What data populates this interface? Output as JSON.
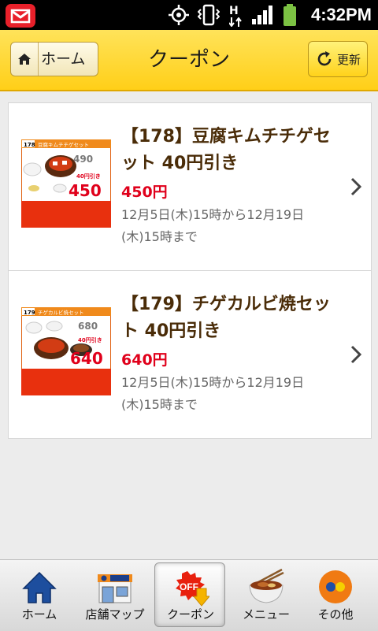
{
  "status_bar": {
    "time": "4:32PM",
    "icons": [
      "mail-icon",
      "gps-icon",
      "vibrate-icon",
      "data-hplus-icon",
      "signal-icon",
      "battery-icon"
    ],
    "network_label": "H"
  },
  "header": {
    "home_label": "ホーム",
    "title": "クーポン",
    "refresh_label": "更新"
  },
  "coupons": [
    {
      "title": "【178】豆腐キムチチゲセット 40円引き",
      "price": "450円",
      "period": "12月5日(木)15時から12月19日(木)15時まで",
      "thumb": {
        "number": "178",
        "name": "豆腐キムチチゲセット",
        "old_price": "490",
        "discount": "40円引き",
        "new_price": "450"
      }
    },
    {
      "title": "【179】チゲカルビ焼セット 40円引き",
      "price": "640円",
      "period": "12月5日(木)15時から12月19日(木)15時まで",
      "thumb": {
        "number": "179",
        "name": "チゲカルビ焼セット",
        "old_price": "680",
        "discount": "40円引き",
        "new_price": "640"
      }
    }
  ],
  "tabs": [
    {
      "label": "ホーム",
      "icon": "home-icon",
      "active": false
    },
    {
      "label": "店舗マップ",
      "icon": "store-icon",
      "active": false
    },
    {
      "label": "クーポン",
      "icon": "off-coupon-icon",
      "active": true
    },
    {
      "label": "メニュー",
      "icon": "rice-bowl-icon",
      "active": false
    },
    {
      "label": "その他",
      "icon": "dots-icon",
      "active": false
    }
  ],
  "colors": {
    "header_yellow": "#ffd21a",
    "title_brown": "#4a2c08",
    "price_red": "#e0001b",
    "status_bar": "#000000"
  }
}
